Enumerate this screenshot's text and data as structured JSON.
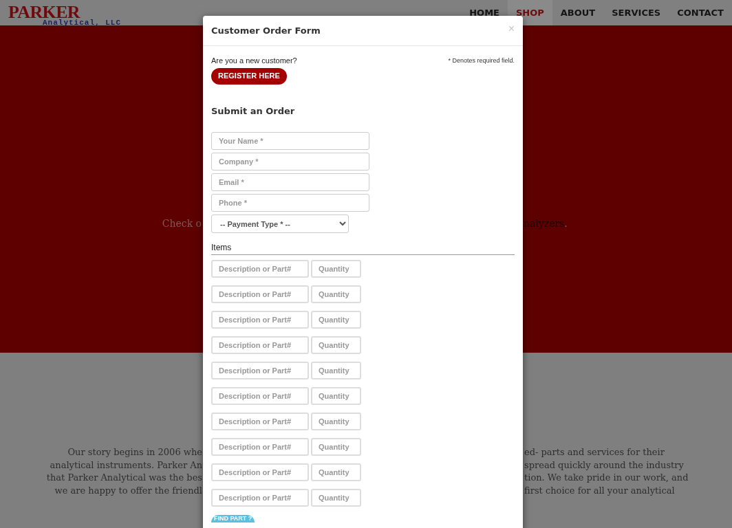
{
  "nav": {
    "logo": {
      "name": "PARKER",
      "subtitle": "Analytical, LLC"
    },
    "items": [
      {
        "label": "HOME",
        "selected": false
      },
      {
        "label": "SHOP",
        "selected": true
      },
      {
        "label": "ABOUT",
        "selected": false
      },
      {
        "label": "SERVICES",
        "selected": false
      },
      {
        "label": "CONTACT",
        "selected": false
      }
    ]
  },
  "hero": {
    "text_left": "Check o",
    "link": "nalyzers",
    "text_right": "."
  },
  "about": {
    "lines": [
      {
        "left": "Our story begins in 2006 whe",
        "right": "ed- parts and services for their"
      },
      {
        "left": "analytical instruments. Parker An",
        "right": "spread quickly around the industry"
      },
      {
        "left": "that Parker Analytical was the bes",
        "right": "tion. We take pride in our work, and"
      },
      {
        "left": "we are happy to offer the friendl",
        "right": "first choice for all your analytical"
      }
    ]
  },
  "modal": {
    "title": "Customer Order Form",
    "close": "×",
    "new_customer": "Are you a new customer?",
    "register_button": "REGISTER HERE",
    "required_note": "* Denotes required field.",
    "section_title": "Submit an Order",
    "fields": [
      {
        "placeholder": "Your Name *"
      },
      {
        "placeholder": "Company *"
      },
      {
        "placeholder": "Email *"
      },
      {
        "placeholder": "Phone *"
      }
    ],
    "payment": {
      "placeholder": "-- Payment Type * --"
    },
    "items_title": "Items",
    "items": [
      {
        "description_placeholder": "Description or Part#",
        "quantity_placeholder": "Quantity"
      },
      {
        "description_placeholder": "Description or Part#",
        "quantity_placeholder": "Quantity"
      },
      {
        "description_placeholder": "Description or Part#",
        "quantity_placeholder": "Quantity"
      },
      {
        "description_placeholder": "Description or Part#",
        "quantity_placeholder": "Quantity"
      },
      {
        "description_placeholder": "Description or Part#",
        "quantity_placeholder": "Quantity"
      },
      {
        "description_placeholder": "Description or Part#",
        "quantity_placeholder": "Quantity"
      },
      {
        "description_placeholder": "Description or Part#",
        "quantity_placeholder": "Quantity"
      },
      {
        "description_placeholder": "Description or Part#",
        "quantity_placeholder": "Quantity"
      },
      {
        "description_placeholder": "Description or Part#",
        "quantity_placeholder": "Quantity"
      },
      {
        "description_placeholder": "Description or Part#",
        "quantity_placeholder": "Quantity"
      }
    ],
    "find_part_button": "FIND PART ?"
  }
}
